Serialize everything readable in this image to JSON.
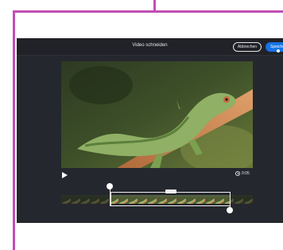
{
  "window": {
    "title": "Video schneiden"
  },
  "header": {
    "cancel_label": "Abbrechen",
    "save_label": "Speichern"
  },
  "player": {
    "time": "0:05",
    "play_icon": "play-icon",
    "clock_icon": "clock-icon"
  },
  "trimmer": {
    "selection_start": 0.26,
    "selection_end": 0.88,
    "frame_count": 20
  },
  "colors": {
    "accent": "#1473e6",
    "frame": "#c24fb3",
    "panel": "#25272e",
    "header": "#202227"
  }
}
